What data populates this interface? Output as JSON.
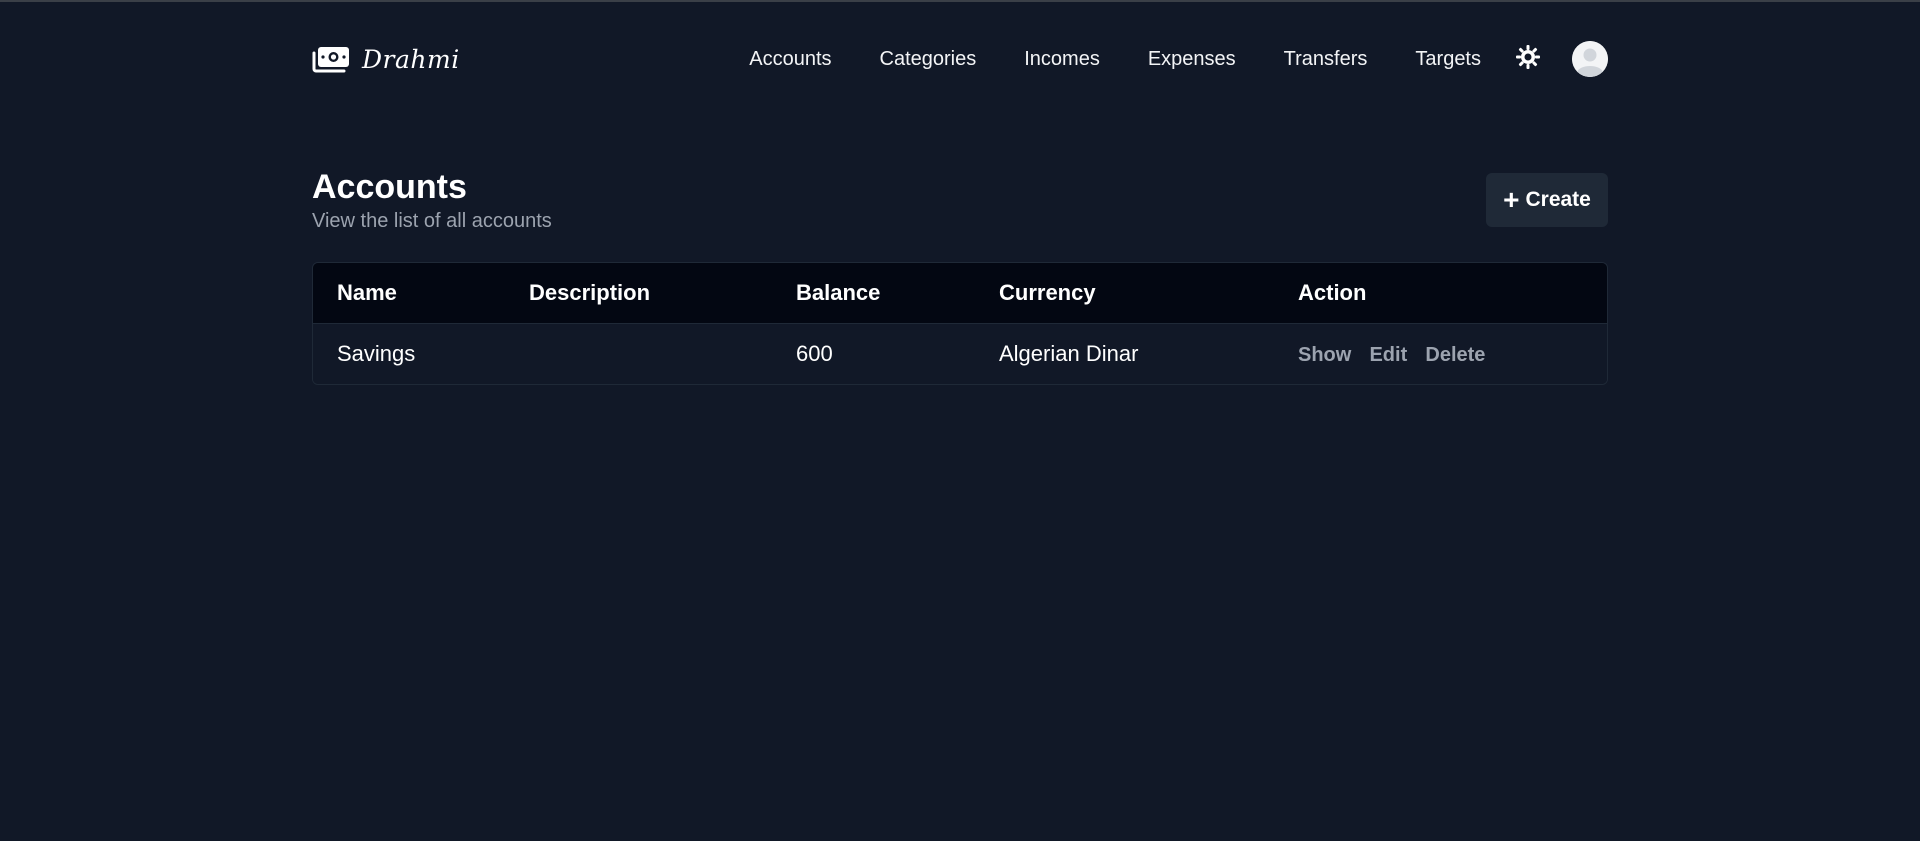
{
  "brand": {
    "name": "Drahmi",
    "logo_icon": "money-bill-icon"
  },
  "nav": {
    "items": [
      {
        "label": "Accounts"
      },
      {
        "label": "Categories"
      },
      {
        "label": "Incomes"
      },
      {
        "label": "Expenses"
      },
      {
        "label": "Transfers"
      },
      {
        "label": "Targets"
      }
    ],
    "theme_icon": "sun-icon",
    "avatar_icon": "user-avatar-icon"
  },
  "page": {
    "title": "Accounts",
    "subtitle": "View the list of all accounts",
    "create_label": "Create",
    "create_icon": "plus-icon"
  },
  "table": {
    "headers": [
      "Name",
      "Description",
      "Balance",
      "Currency",
      "Action"
    ],
    "rows": [
      {
        "name": "Savings",
        "description": "",
        "balance": "600",
        "currency": "Algerian Dinar",
        "actions": [
          "Show",
          "Edit",
          "Delete"
        ]
      }
    ]
  },
  "colors": {
    "background": "#111827",
    "table_header": "#030712",
    "button": "#1f2937",
    "muted_text": "#9ca3af"
  }
}
